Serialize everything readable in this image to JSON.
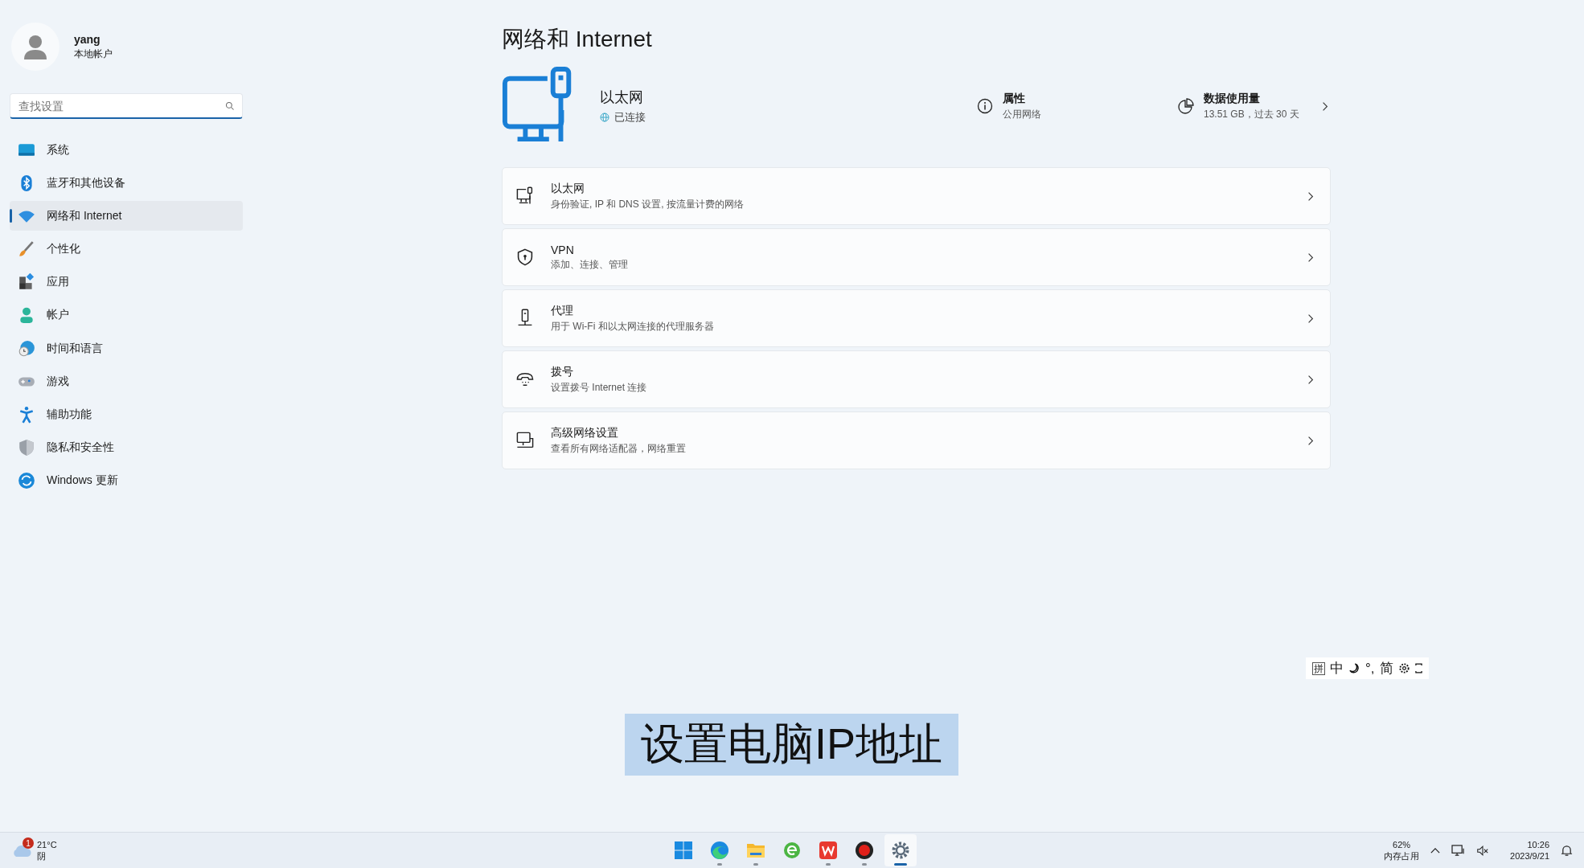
{
  "account": {
    "name": "yang",
    "type": "本地帐户"
  },
  "search": {
    "placeholder": "查找设置"
  },
  "sidebar": {
    "items": [
      {
        "label": "系统",
        "selected": false
      },
      {
        "label": "蓝牙和其他设备",
        "selected": false
      },
      {
        "label": "网络和 Internet",
        "selected": true
      },
      {
        "label": "个性化",
        "selected": false
      },
      {
        "label": "应用",
        "selected": false
      },
      {
        "label": "帐户",
        "selected": false
      },
      {
        "label": "时间和语言",
        "selected": false
      },
      {
        "label": "游戏",
        "selected": false
      },
      {
        "label": "辅助功能",
        "selected": false
      },
      {
        "label": "隐私和安全性",
        "selected": false
      },
      {
        "label": "Windows 更新",
        "selected": false
      }
    ]
  },
  "page_title": "网络和 Internet",
  "connection": {
    "name": "以太网",
    "status": "已连接",
    "properties_title": "属性",
    "properties_value": "公用网络",
    "usage_title": "数据使用量",
    "usage_value": "13.51 GB，过去 30 天"
  },
  "cards": [
    {
      "title": "以太网",
      "subtitle": "身份验证, IP 和 DNS 设置, 按流量计费的网络"
    },
    {
      "title": "VPN",
      "subtitle": "添加、连接、管理"
    },
    {
      "title": "代理",
      "subtitle": "用于 Wi-Fi 和以太网连接的代理服务器"
    },
    {
      "title": "拨号",
      "subtitle": "设置拨号 Internet 连接"
    },
    {
      "title": "高级网络设置",
      "subtitle": "查看所有网络适配器，网络重置"
    }
  ],
  "ime_toolbar": [
    {
      "kind": "boxed",
      "text": "拼"
    },
    {
      "kind": "text",
      "text": "中"
    },
    {
      "kind": "moon"
    },
    {
      "kind": "text",
      "text": "°,"
    },
    {
      "kind": "text",
      "text": "简"
    },
    {
      "kind": "gear"
    },
    {
      "kind": "expand"
    }
  ],
  "caption": "设置电脑IP地址",
  "taskbar": {
    "weather_badge": "1",
    "temperature": "21°C",
    "condition": "阴",
    "apps": [
      {
        "kind": "start",
        "running": false,
        "selected": false
      },
      {
        "kind": "edge",
        "running": true,
        "selected": false
      },
      {
        "kind": "folder",
        "running": true,
        "selected": false
      },
      {
        "kind": "browser",
        "running": false,
        "selected": false
      },
      {
        "kind": "wps",
        "running": true,
        "selected": false
      },
      {
        "kind": "record",
        "running": true,
        "selected": false
      },
      {
        "kind": "settings",
        "running": true,
        "selected": true
      }
    ],
    "memory_percent": "62%",
    "memory_label": "内存占用",
    "time": "10:26",
    "date": "2023/9/21"
  }
}
